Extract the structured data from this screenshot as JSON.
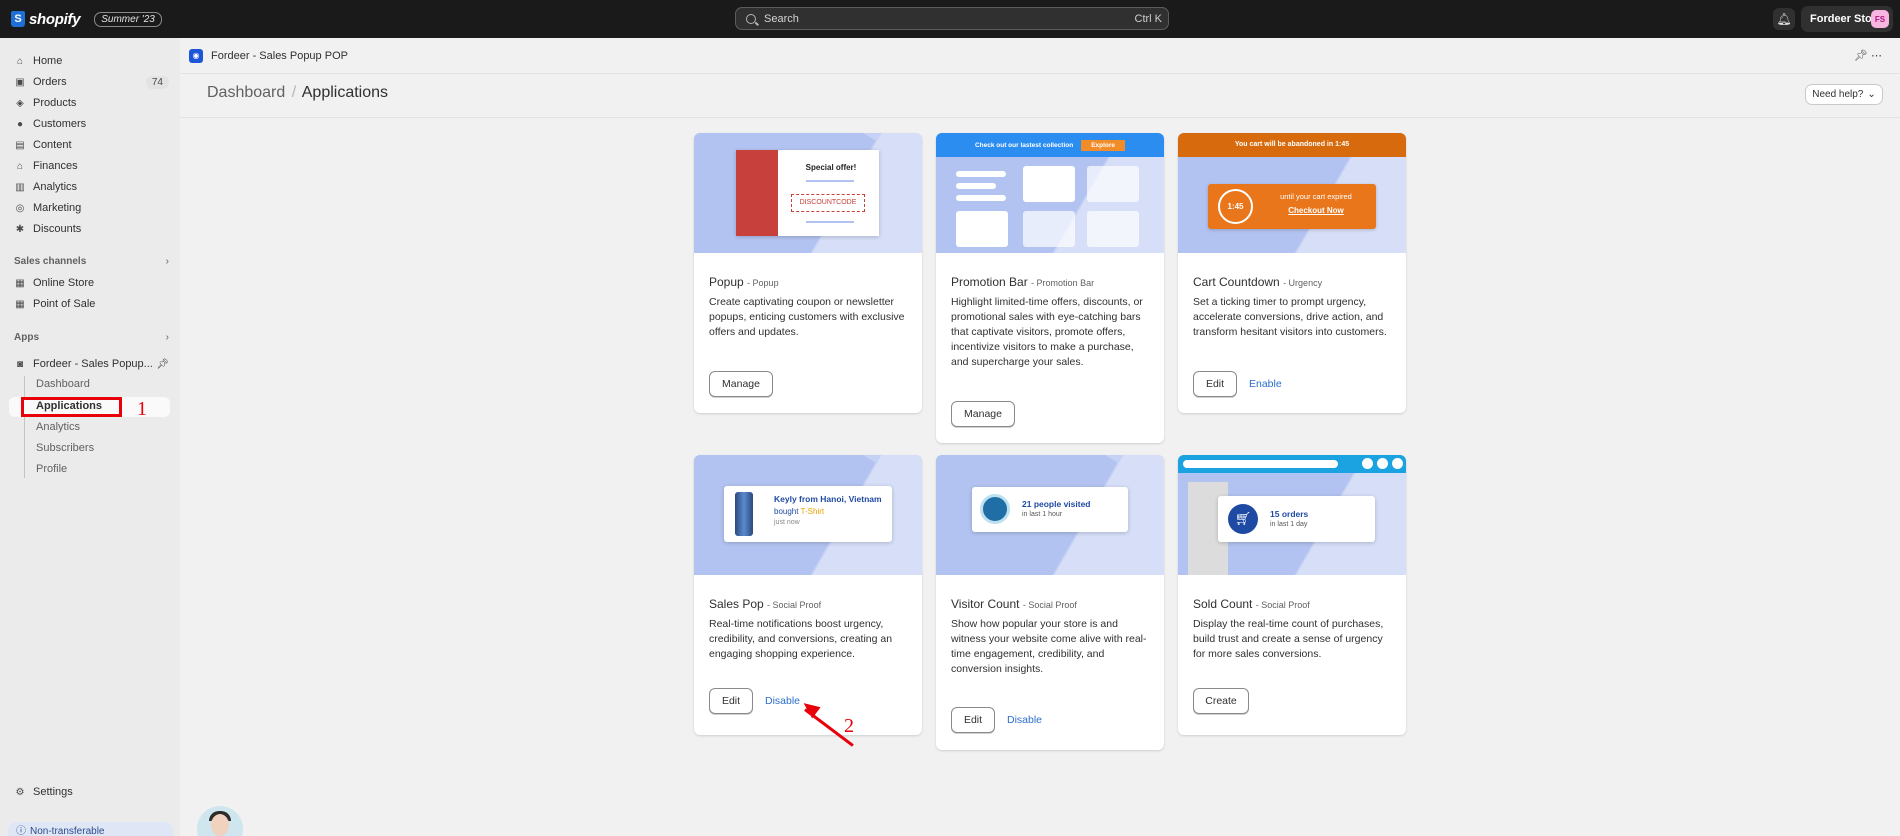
{
  "topbar": {
    "brand": "shopify",
    "edition": "Summer '23",
    "search_placeholder": "Search",
    "search_shortcut": "Ctrl K",
    "store_name": "Fordeer Store",
    "store_initials": "FS"
  },
  "sidebar": {
    "items": [
      {
        "label": "Home",
        "icon": "home-icon",
        "glyph": "⌂"
      },
      {
        "label": "Orders",
        "icon": "orders-icon",
        "glyph": "▣",
        "badge": "74"
      },
      {
        "label": "Products",
        "icon": "tag-icon",
        "glyph": "◈"
      },
      {
        "label": "Customers",
        "icon": "person-icon",
        "glyph": "●"
      },
      {
        "label": "Content",
        "icon": "content-icon",
        "glyph": "▤"
      },
      {
        "label": "Finances",
        "icon": "bank-icon",
        "glyph": "⌂"
      },
      {
        "label": "Analytics",
        "icon": "bar-chart-icon",
        "glyph": "▥"
      },
      {
        "label": "Marketing",
        "icon": "target-icon",
        "glyph": "◎"
      },
      {
        "label": "Discounts",
        "icon": "discount-icon",
        "glyph": "✱"
      }
    ],
    "sales_channels_label": "Sales channels",
    "channels": [
      {
        "label": "Online Store",
        "glyph": "▦"
      },
      {
        "label": "Point of Sale",
        "glyph": "▦"
      }
    ],
    "apps_label": "Apps",
    "app_name": "Fordeer - Sales Popup...",
    "app_subitems": [
      "Dashboard",
      "Applications",
      "Analytics",
      "Subscribers",
      "Profile"
    ],
    "settings_label": "Settings",
    "bottom_notice": "Non-transferable"
  },
  "annotations": {
    "step1": "1",
    "step2": "2"
  },
  "appbar": {
    "title": "Fordeer - Sales Popup POP"
  },
  "page": {
    "breadcrumb_parent": "Dashboard",
    "breadcrumb_sep": "/",
    "breadcrumb_current": "Applications",
    "help_label": "Need help?"
  },
  "cards": [
    {
      "title": "Popup",
      "category": "- Popup",
      "description": "Create captivating coupon or newsletter popups, enticing customers with exclusive offers and updates.",
      "preview_title": "Special offer!",
      "preview_code": "DISCOUNTCODE",
      "primary": "Manage"
    },
    {
      "title": "Promotion Bar",
      "category": "- Promotion Bar",
      "description": "Highlight limited-time offers, discounts, or promotional sales with eye-catching bars that captivate visitors, promote offers, incentivize visitors to make a purchase, and supercharge your sales.",
      "preview_bar_text": "Check out our lastest collection",
      "preview_button": "Explore",
      "primary": "Manage"
    },
    {
      "title": "Cart Countdown",
      "category": "- Urgency",
      "description": "Set a ticking timer to prompt urgency, accelerate conversions, drive action, and transform hesitant visitors into customers.",
      "preview_bar_text": "You cart will be abandoned in 1:45",
      "preview_timer": "1:45",
      "preview_line1": "until your cart expired",
      "preview_line2": "Checkout Now",
      "primary": "Edit",
      "secondary": "Enable"
    },
    {
      "title": "Sales Pop",
      "category": "- Social Proof",
      "description": "Real-time notifications boost urgency, credibility, and conversions, creating an engaging shopping experience.",
      "preview_line1": "Keyly from Hanoi, Vietnam",
      "preview_line2a": "bought ",
      "preview_line2b": "T-Shirt",
      "preview_line3": "just now",
      "primary": "Edit",
      "secondary": "Disable"
    },
    {
      "title": "Visitor Count",
      "category": "- Social Proof",
      "description": "Show how popular your store is and witness your website come alive with real-time engagement, credibility, and conversion insights.",
      "preview_line1": "21 people visited",
      "preview_line2": "in last 1 hour",
      "primary": "Edit",
      "secondary": "Disable"
    },
    {
      "title": "Sold Count",
      "category": "- Social Proof",
      "description": "Display the real-time count of purchases, build trust and create a sense of urgency for more sales conversions.",
      "preview_line1": "15 orders",
      "preview_line2": "in last 1 day",
      "primary": "Create"
    }
  ],
  "colors": {
    "accent_link": "#2c6ecb",
    "annotation_red": "#e8000b",
    "hero_blue": "#c6d2f5",
    "urgency_orange": "#e9761b"
  }
}
